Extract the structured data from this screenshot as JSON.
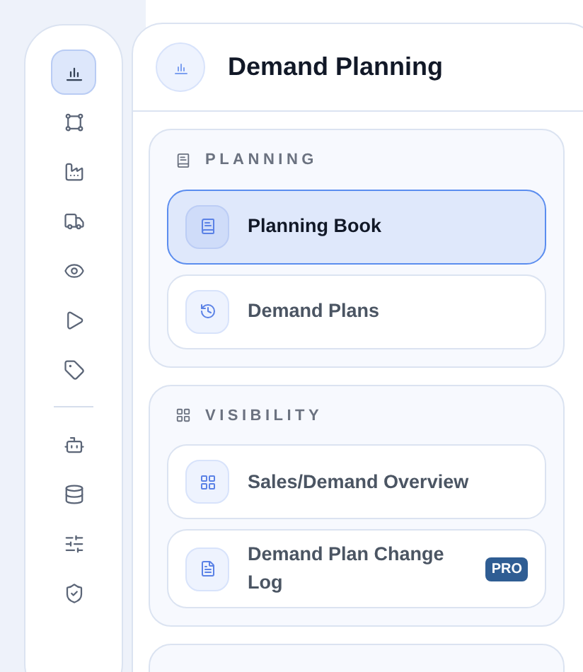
{
  "sidebar": {
    "groups": [
      [
        {
          "selected": true
        },
        {
          "selected": false
        },
        {
          "selected": false
        },
        {
          "selected": false
        },
        {
          "selected": false
        },
        {
          "selected": false
        },
        {
          "selected": false
        }
      ],
      [
        {
          "selected": false
        },
        {
          "selected": false
        },
        {
          "selected": false
        },
        {
          "selected": false
        }
      ]
    ]
  },
  "panel": {
    "title": "Demand Planning",
    "sections": [
      {
        "heading": "PLANNING",
        "items": [
          {
            "label": "Planning Book",
            "selected": true
          },
          {
            "label": "Demand Plans",
            "selected": false
          }
        ]
      },
      {
        "heading": "VISIBILITY",
        "items": [
          {
            "label": "Sales/Demand Overview",
            "selected": false
          },
          {
            "label": "Demand Plan Change Log",
            "selected": false,
            "badge": "PRO"
          }
        ]
      }
    ]
  }
}
